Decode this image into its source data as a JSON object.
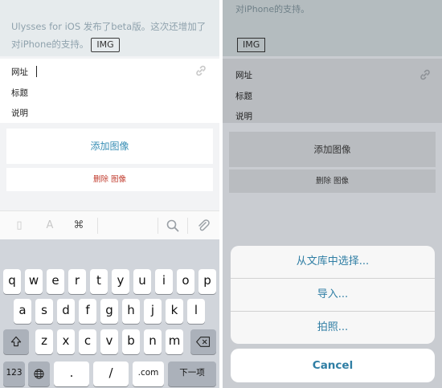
{
  "left": {
    "editor_text": "Ulysses for iOS 发布了beta版。这次还增加了对iPhone的支持。",
    "img_tag": "IMG",
    "fields": {
      "url": "网址",
      "title": "标题",
      "desc": "说明"
    },
    "add_image": "添加图像",
    "delete_image": "删除 图像",
    "toolbar": {
      "cmd_icon": "⌘"
    },
    "keyboard": {
      "row1": [
        "q",
        "w",
        "e",
        "r",
        "t",
        "y",
        "u",
        "i",
        "o",
        "p"
      ],
      "row2": [
        "a",
        "s",
        "d",
        "f",
        "g",
        "h",
        "j",
        "k",
        "l"
      ],
      "row3": [
        "z",
        "x",
        "c",
        "v",
        "b",
        "n",
        "m"
      ],
      "num_key": "123",
      "dot_key": ".",
      "slash_key": "/",
      "com_key": ".com",
      "next_key": "下一项"
    }
  },
  "right": {
    "editor_text": "对iPhone的支持。",
    "img_tag": "IMG",
    "fields": {
      "url": "网址",
      "title": "标题",
      "desc": "说明"
    },
    "add_image": "添加图像",
    "delete_image": "删除 图像",
    "sheet": {
      "items": [
        "从文库中选择...",
        "导入...",
        "拍照..."
      ],
      "cancel": "Cancel"
    }
  },
  "colors": {
    "accent": "#2f7ea4",
    "destructive": "#c0392b",
    "keyboard_bg": "#d1d5db"
  }
}
